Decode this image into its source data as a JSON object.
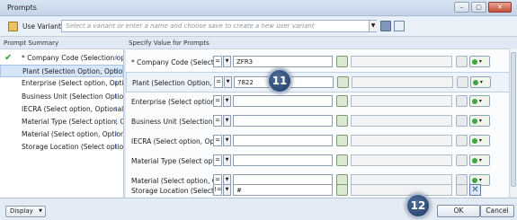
{
  "window": {
    "title": "Prompts",
    "buttons": [
      "–",
      "▢",
      "✕"
    ]
  },
  "variant": {
    "label": "Use Variant",
    "placeholder": "Select a variant or enter a name and choose save to create a new user variant"
  },
  "prompt_summary": {
    "header": "Prompt Summary",
    "items": [
      {
        "label": "* Company Code (Selection option",
        "checked": true
      },
      {
        "label": "Plant (Selection Option, Optional):",
        "selected": true
      },
      {
        "label": "Enterprise (Select option, Optional"
      },
      {
        "label": "Business Unit (Selection Option, O"
      },
      {
        "label": "IECRA (Select option, Optional):"
      },
      {
        "label": "Material Type (Select option, Optio"
      },
      {
        "label": "Material (Select option, Optional):"
      },
      {
        "label": "Storage Location (Select option, O"
      }
    ]
  },
  "values": {
    "header": "Specify Value for Prompts",
    "rows": [
      {
        "label": "* Company Code (Selection op",
        "operator": "=",
        "value": "ZFR3"
      },
      {
        "label": "Plant (Selection Option, Option",
        "operator": "=",
        "value": "7822"
      },
      {
        "label": "Enterprise (Select option, Opti",
        "operator": "=",
        "value": ""
      },
      {
        "label": "Business Unit (Selection Optio",
        "operator": "=",
        "value": ""
      },
      {
        "label": "IECRA (Select option, Optional",
        "operator": "=",
        "value": ""
      },
      {
        "label": "Material Type (Select option, O",
        "operator": "=",
        "value": ""
      },
      {
        "label": "Material (Select option, Option",
        "operator": "=",
        "value": ""
      },
      {
        "label": "Storage Location (Select optio",
        "operator": "!=",
        "value": "#"
      }
    ]
  },
  "callouts": {
    "first": "11",
    "second": "12"
  },
  "footer": {
    "display_label": "Display",
    "ok_label": "OK",
    "cancel_label": "Cancel"
  }
}
